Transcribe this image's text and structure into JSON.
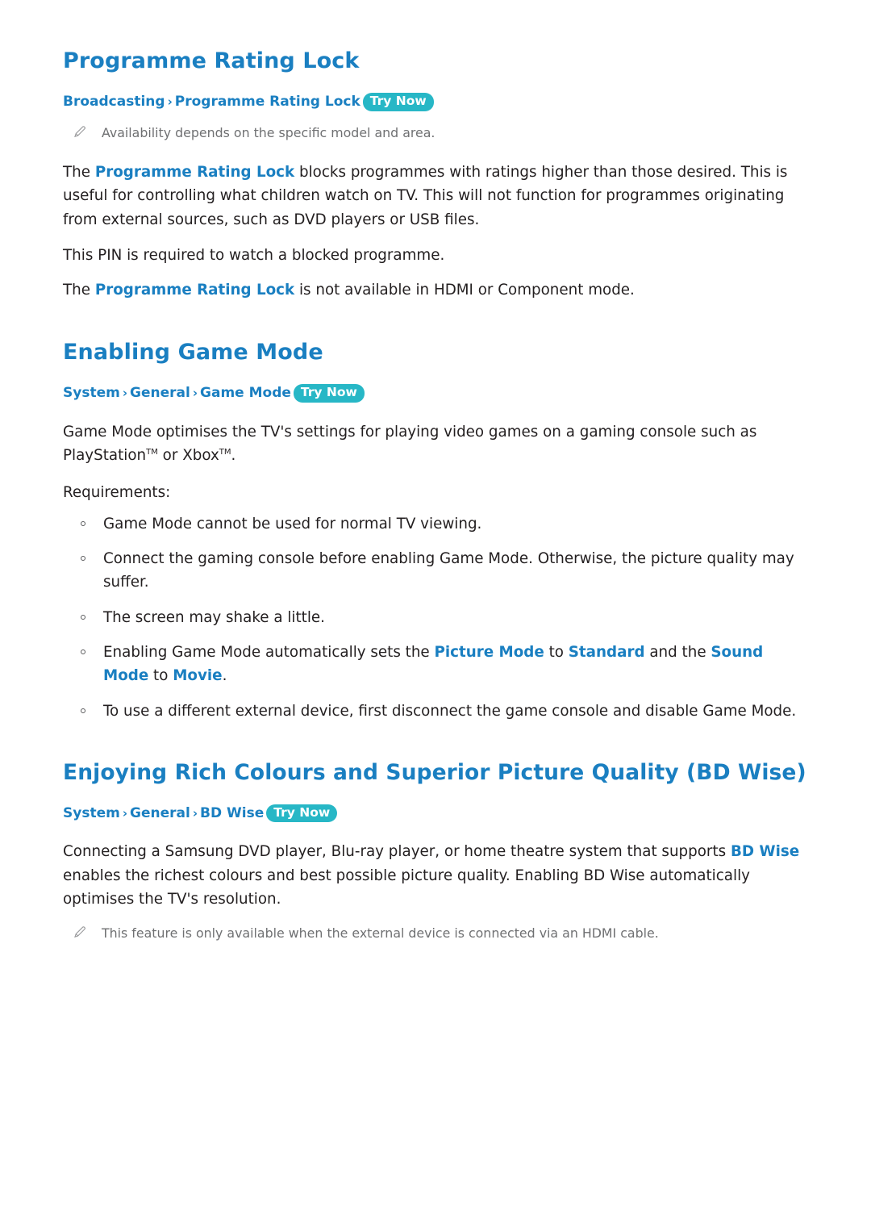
{
  "sections": [
    {
      "title": "Programme Rating Lock",
      "path": {
        "parts": [
          "Broadcasting",
          "Programme Rating Lock"
        ],
        "try_now": "Try Now"
      },
      "note": "Availability depends on the specific model and area.",
      "paragraphs": [
        {
          "runs": [
            {
              "t": "The ",
              "s": "n"
            },
            {
              "t": "Programme Rating Lock",
              "s": "b"
            },
            {
              "t": " blocks programmes with ratings higher than those desired. This is useful for controlling what children watch on TV. This will not function for programmes originating from external sources, such as DVD players or USB files.",
              "s": "n"
            }
          ]
        },
        {
          "runs": [
            {
              "t": "This PIN is required to watch a blocked programme.",
              "s": "n"
            }
          ]
        },
        {
          "runs": [
            {
              "t": "The ",
              "s": "n"
            },
            {
              "t": "Programme Rating Lock",
              "s": "b"
            },
            {
              "t": " is not available in HDMI or Component mode.",
              "s": "n"
            }
          ]
        }
      ]
    },
    {
      "title": "Enabling Game Mode",
      "path": {
        "parts": [
          "System",
          "General",
          "Game Mode"
        ],
        "try_now": "Try Now"
      },
      "paragraphs": [
        {
          "runs": [
            {
              "t": "Game Mode optimises the TV's settings for playing video games on a gaming console such as PlayStation",
              "s": "n"
            },
            {
              "t": "TM",
              "s": "tm"
            },
            {
              "t": " or Xbox",
              "s": "n"
            },
            {
              "t": "TM",
              "s": "tm"
            },
            {
              "t": ".",
              "s": "n"
            }
          ]
        }
      ],
      "requirements_label": "Requirements:",
      "bullets": [
        {
          "runs": [
            {
              "t": "Game Mode cannot be used for normal TV viewing.",
              "s": "n"
            }
          ]
        },
        {
          "runs": [
            {
              "t": "Connect the gaming console before enabling Game Mode. Otherwise, the picture quality may suffer.",
              "s": "n"
            }
          ]
        },
        {
          "runs": [
            {
              "t": "The screen may shake a little.",
              "s": "n"
            }
          ]
        },
        {
          "runs": [
            {
              "t": "Enabling Game Mode automatically sets the ",
              "s": "n"
            },
            {
              "t": "Picture Mode",
              "s": "b"
            },
            {
              "t": " to ",
              "s": "n"
            },
            {
              "t": "Standard",
              "s": "b"
            },
            {
              "t": " and the ",
              "s": "n"
            },
            {
              "t": "Sound Mode",
              "s": "b"
            },
            {
              "t": " to ",
              "s": "n"
            },
            {
              "t": "Movie",
              "s": "b"
            },
            {
              "t": ".",
              "s": "n"
            }
          ]
        },
        {
          "runs": [
            {
              "t": "To use a different external device, first disconnect the game console and disable Game Mode.",
              "s": "n"
            }
          ]
        }
      ]
    },
    {
      "title": "Enjoying Rich Colours and Superior Picture Quality (BD Wise)",
      "path": {
        "parts": [
          "System",
          "General",
          "BD Wise"
        ],
        "try_now": "Try Now"
      },
      "paragraphs": [
        {
          "runs": [
            {
              "t": "Connecting a Samsung DVD player, Blu-ray player, or home theatre system that supports ",
              "s": "n"
            },
            {
              "t": "BD Wise",
              "s": "b"
            },
            {
              "t": " enables the richest colours and best possible picture quality. Enabling BD Wise automatically optimises the TV's resolution.",
              "s": "n"
            }
          ]
        }
      ],
      "note": "This feature is only available when the external device is connected via an HDMI cable."
    }
  ],
  "colors": {
    "heading_blue": "#1a7fc1",
    "try_now_bg": "#27b7c6",
    "note_grey": "#6f7072",
    "body_black": "#231f20"
  },
  "icons": {
    "pencil": "pencil-note-icon",
    "separator": "›"
  }
}
